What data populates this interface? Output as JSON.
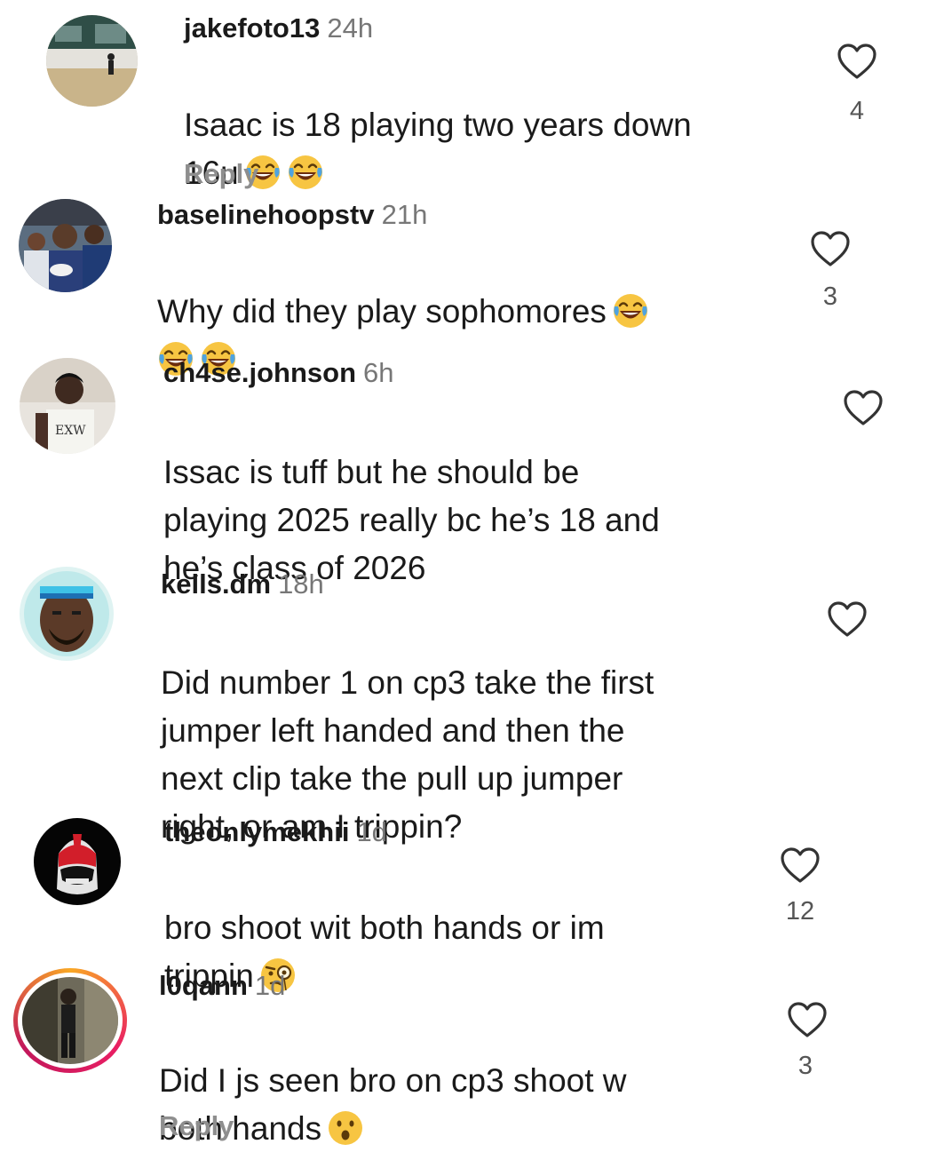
{
  "comments": [
    {
      "username": "jakefoto13",
      "time": "24h",
      "text": "Isaac is 18 playing two years down\n16u",
      "emojis": [
        "face-with-tears-of-joy",
        "face-with-tears-of-joy"
      ],
      "reply_label": "Reply",
      "likes": "4",
      "avatar": "gym-court-photo"
    },
    {
      "username": "baselinehoopstv",
      "time": "21h",
      "text": "Why did they play sophomores",
      "emojis": [
        "face-with-tears-of-joy",
        "face-with-tears-of-joy",
        "face-with-tears-of-joy"
      ],
      "likes": "3",
      "avatar": "basketball-players-photo"
    },
    {
      "username": "ch4se.johnson",
      "time": "6h",
      "text": "Issac is tuff but he should be\nplaying 2025 really bc he’s 18 and\nhe’s class of 2026",
      "likes": "",
      "avatar": "player-jersey-photo"
    },
    {
      "username": "kells.dm",
      "time": "18h",
      "text": "Did number 1 on cp3 take the first\njumper left handed and then the\nnext clip take the pull up jumper\nright, or am I trippin?",
      "likes": "",
      "avatar": "man-with-headband-photo"
    },
    {
      "username": "theonlymekhii",
      "time": "1d",
      "text": "bro shoot wit both hands or im\ntrippin",
      "emojis": [
        "face-with-monocle"
      ],
      "likes": "12",
      "avatar": "red-ranger-helmet"
    },
    {
      "username": "l0qann",
      "time": "1d",
      "text": "Did I js seen bro on cp3 shoot w\nboth hands",
      "emojis": [
        "face-with-open-mouth"
      ],
      "reply_label": "Reply",
      "likes": "3",
      "avatar": "person-standing-photo-story-ring"
    }
  ],
  "colors": {
    "text": "#1a1a1a",
    "meta": "#777777",
    "reply": "#8e8e8e",
    "story_ring_start": "#f9a825",
    "story_ring_end": "#c2185b"
  }
}
